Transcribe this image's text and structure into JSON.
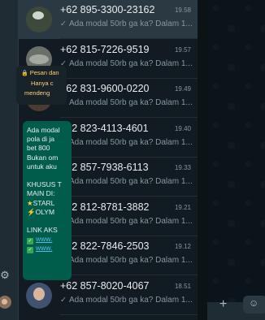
{
  "chats": [
    {
      "name": "+62 895-3300-23162",
      "time": "19.58",
      "preview": "Ada modal 50rb ga ka? Dalam 1...",
      "avatar": "photo-bike",
      "active": true
    },
    {
      "name": "+62 815-7226-9519",
      "time": "19.57",
      "preview": "Ada modal 50rb ga ka? Dalam 1...",
      "avatar": "photo-car",
      "active": false
    },
    {
      "name": "+62 831-9600-0220",
      "time": "19.49",
      "preview": "Ada modal 50rb ga ka? Dalam 1...",
      "avatar": "photo-person",
      "active": false
    },
    {
      "name": "+62 823-4113-4601",
      "time": "19.40",
      "preview": "Ada modal 50rb ga ka? Dalam 1...",
      "avatar": "default",
      "active": false
    },
    {
      "name": "+62 857-7938-6113",
      "time": "19.33",
      "preview": "Ada modal 50rb ga ka? Dalam 1...",
      "avatar": "default",
      "active": false
    },
    {
      "name": "+62 812-8781-3882",
      "time": "19.21",
      "preview": "Ada modal 50rb ga ka? Dalam 1...",
      "avatar": "photo-woman",
      "active": false
    },
    {
      "name": "+62 822-7846-2503",
      "time": "19.12",
      "preview": "Ada modal 50rb ga ka? Dalam 1...",
      "avatar": "photo-hands",
      "active": false
    },
    {
      "name": "+62 857-8020-4067",
      "time": "18.51",
      "preview": "Ada modal 50rb ga ka? Dalam 1...",
      "avatar": "photo-girl",
      "active": false
    }
  ],
  "encryption": {
    "line1": "Pesan dan",
    "line2": "Hanya c",
    "line3": "mendeng"
  },
  "message": {
    "lines": [
      "Ada modal",
      "pola di ja",
      "bet 800",
      "Bukan om",
      "untuk aku",
      "",
      "KHUSUS T",
      "MAIN DI:",
      "STARL",
      "OLYM",
      "",
      "LINK AKS",
      "www.",
      "www."
    ]
  },
  "icons": {
    "settings": "gear-icon",
    "read_receipt": "double-check-icon",
    "attach": "plus-icon",
    "sticker": "sticker-icon"
  }
}
